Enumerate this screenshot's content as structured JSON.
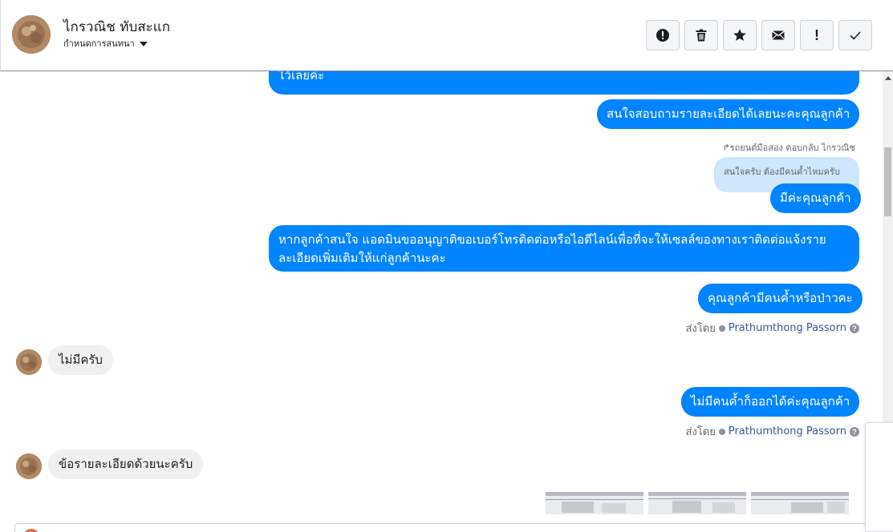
{
  "header": {
    "contact_name": "ไกรวณิช ทับสะแก",
    "label_dropdown": "กำหนดการสนทนา",
    "actions": [
      {
        "name": "alert-circle",
        "label": ""
      },
      {
        "name": "trash",
        "label": ""
      },
      {
        "name": "star",
        "label": ""
      },
      {
        "name": "envelope",
        "label": ""
      },
      {
        "name": "exclamation",
        "label": "!"
      },
      {
        "name": "checkmark",
        "label": ""
      }
    ]
  },
  "messages": {
    "m1": "ไว้เลยค่ะ",
    "m2": "สนใจสอบถามรายละเอียดได้เลยนะคะคุณลูกค้า",
    "reply_note": "รถยนต์มือสอง ตอบกลับ ไกรวณิช",
    "quoted": "สนใจครับ ต้องมีคนค้ำไหมครับ",
    "m3": "มีค่ะคุณลูกค้า",
    "m4": "หากลูกค้าสนใจ แอดมินขออนุญาติขอเบอร์โทรติดต่อหรือไอดีไลน์เพื่อที่จะให้เซลล์ของทางเราติดต่อแจ้งราย ละเอียดเพิ่มเติมให้แก่ลูกค้านะคะ",
    "m5": "คุณลูกค้ามีคนค้ำหรือป่าวคะ",
    "in1": "ไม่มีครับ",
    "m6": "ไม่มีคนค้ำก็ออกได้ค่ะคุณลูกค้า",
    "in2": "ข้อรายละเอียดด้วยนะครับ"
  },
  "sent_by": {
    "prefix": "ส่งโดย",
    "name": "Prathumthong Passorn",
    "help": "?"
  }
}
